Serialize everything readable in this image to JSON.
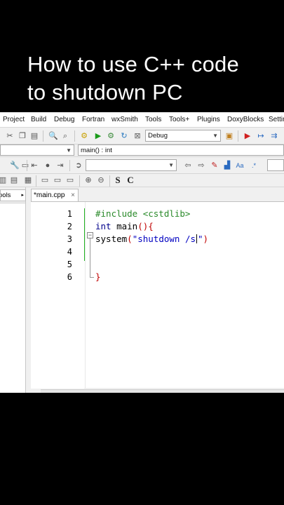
{
  "caption": {
    "line1": "How to use C++ code",
    "line2": "to shutdown PC"
  },
  "menu": {
    "items": [
      "Project",
      "Build",
      "Debug",
      "Fortran",
      "wxSmith",
      "Tools",
      "Tools+",
      "Plugins",
      "DoxyBlocks",
      "Settin"
    ]
  },
  "toolbar": {
    "build_target": "Debug",
    "scope_value": "main() : int",
    "search_value": "",
    "glyph_s": "S",
    "glyph_c": "C"
  },
  "left_panel": {
    "tab_label": "ools"
  },
  "editor": {
    "file_tab": "*main.cpp",
    "close_glyph": "×",
    "line_numbers": [
      "1",
      "2",
      "3",
      "4",
      "5",
      "6"
    ],
    "code": {
      "l1": "#include <cstdlib>",
      "l2_kw": "int",
      "l2_rest": " main",
      "l2_paren": "(){",
      "l3_a": "",
      "l3_fn": "system",
      "l3_open": "(",
      "l3_str": "\"shutdown /s",
      "l3_strend": "\"",
      "l3_close": ")",
      "l6": "}"
    }
  },
  "colors": {
    "accent_green": "#21b321",
    "keyword": "#00008b",
    "string": "#0000c0",
    "preprocessor": "#2a8a2a"
  }
}
